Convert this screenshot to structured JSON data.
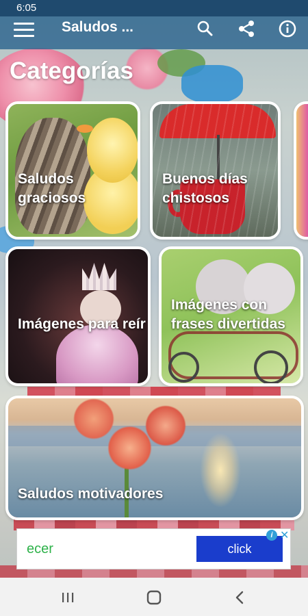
{
  "status_bar": {
    "time": "6:05"
  },
  "app_bar": {
    "title": "Saludos ...",
    "icons": [
      "menu-icon",
      "search-icon",
      "share-icon",
      "info-icon"
    ]
  },
  "section_title": "Categorías",
  "categories": [
    {
      "label": "Saludos graciosos"
    },
    {
      "label": "Buenos días chistosos"
    },
    {
      "label": "Imágenes para reír"
    },
    {
      "label": "Imágenes con frases divertidas"
    },
    {
      "label": "Saludos motivadores"
    }
  ],
  "ad": {
    "brand": "ecer",
    "cta": "click",
    "info_glyph": "i",
    "close_glyph": "✕",
    "colors": {
      "brand": "#2eb24a",
      "cta_bg": "#1a3dcc"
    }
  },
  "nav_bar": {
    "icons": [
      "recent-apps-icon",
      "home-icon",
      "back-icon"
    ]
  },
  "colors": {
    "app_bar": "#27608c",
    "status_bar": "#1f4a6e",
    "card_border": "#ffffff"
  }
}
